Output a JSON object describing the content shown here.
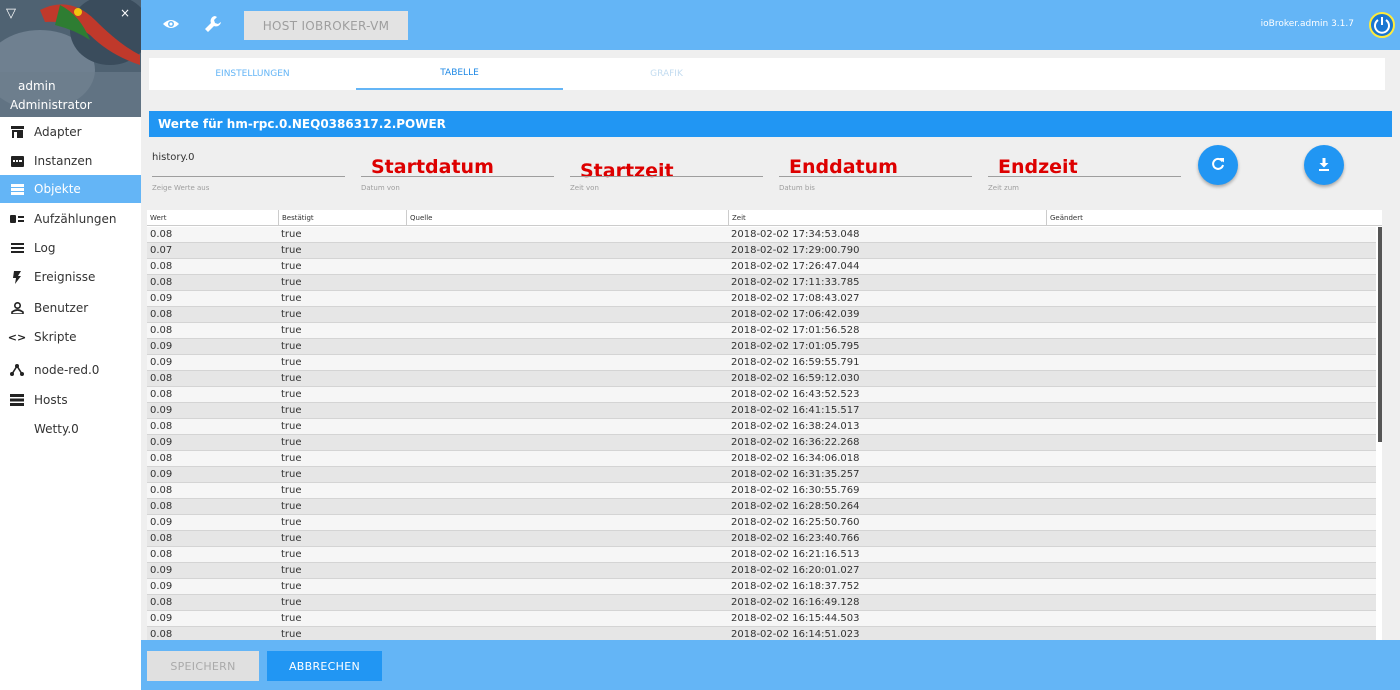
{
  "sidebar": {
    "user_name": "admin",
    "user_role": "Administrator",
    "items": [
      {
        "label": "Adapter",
        "icon": "store-icon"
      },
      {
        "label": "Instanzen",
        "icon": "instances-icon"
      },
      {
        "label": "Objekte",
        "icon": "list-icon",
        "active": true
      },
      {
        "label": "Aufzählungen",
        "icon": "enum-icon"
      },
      {
        "label": "Log",
        "icon": "log-icon"
      },
      {
        "label": "Ereignisse",
        "icon": "flash-icon"
      },
      {
        "label": "Benutzer",
        "icon": "user-icon"
      },
      {
        "label": "Skripte",
        "icon": "code-icon"
      },
      {
        "label": "node-red.0",
        "icon": "nodes-icon"
      },
      {
        "label": "Hosts",
        "icon": "server-icon"
      },
      {
        "label": "Wetty.0",
        "icon": ""
      }
    ]
  },
  "topbar": {
    "host_button": "HOST IOBROKER-VM",
    "version": "ioBroker.admin 3.1.7"
  },
  "tabs": [
    {
      "label": "EINSTELLUNGEN"
    },
    {
      "label": "TABELLE",
      "active": true
    },
    {
      "label": "GRAFIK",
      "disabled": true
    }
  ],
  "title": "Werte für hm-rpc.0.NEQ0386317.2.POWER",
  "fields": {
    "instance": {
      "value": "history.0",
      "label": "Zeige Werte aus"
    },
    "start_date": {
      "annotation": "Startdatum",
      "label": "Datum von"
    },
    "start_time": {
      "annotation": "Startzeit",
      "label": "Zeit von"
    },
    "end_date": {
      "annotation": "Enddatum",
      "label": "Datum bis"
    },
    "end_time": {
      "annotation": "Endzeit",
      "label": "Zeit zum"
    }
  },
  "table": {
    "headers": [
      "Wert",
      "Bestätigt",
      "Quelle",
      "Zeit",
      "Geändert"
    ],
    "rows": [
      [
        "0.08",
        "true",
        "",
        "2018-02-02 17:34:53.048",
        ""
      ],
      [
        "0.07",
        "true",
        "",
        "2018-02-02 17:29:00.790",
        ""
      ],
      [
        "0.08",
        "true",
        "",
        "2018-02-02 17:26:47.044",
        ""
      ],
      [
        "0.08",
        "true",
        "",
        "2018-02-02 17:11:33.785",
        ""
      ],
      [
        "0.09",
        "true",
        "",
        "2018-02-02 17:08:43.027",
        ""
      ],
      [
        "0.08",
        "true",
        "",
        "2018-02-02 17:06:42.039",
        ""
      ],
      [
        "0.08",
        "true",
        "",
        "2018-02-02 17:01:56.528",
        ""
      ],
      [
        "0.09",
        "true",
        "",
        "2018-02-02 17:01:05.795",
        ""
      ],
      [
        "0.09",
        "true",
        "",
        "2018-02-02 16:59:55.791",
        ""
      ],
      [
        "0.08",
        "true",
        "",
        "2018-02-02 16:59:12.030",
        ""
      ],
      [
        "0.08",
        "true",
        "",
        "2018-02-02 16:43:52.523",
        ""
      ],
      [
        "0.09",
        "true",
        "",
        "2018-02-02 16:41:15.517",
        ""
      ],
      [
        "0.08",
        "true",
        "",
        "2018-02-02 16:38:24.013",
        ""
      ],
      [
        "0.09",
        "true",
        "",
        "2018-02-02 16:36:22.268",
        ""
      ],
      [
        "0.08",
        "true",
        "",
        "2018-02-02 16:34:06.018",
        ""
      ],
      [
        "0.09",
        "true",
        "",
        "2018-02-02 16:31:35.257",
        ""
      ],
      [
        "0.08",
        "true",
        "",
        "2018-02-02 16:30:55.769",
        ""
      ],
      [
        "0.08",
        "true",
        "",
        "2018-02-02 16:28:50.264",
        ""
      ],
      [
        "0.09",
        "true",
        "",
        "2018-02-02 16:25:50.760",
        ""
      ],
      [
        "0.08",
        "true",
        "",
        "2018-02-02 16:23:40.766",
        ""
      ],
      [
        "0.08",
        "true",
        "",
        "2018-02-02 16:21:16.513",
        ""
      ],
      [
        "0.09",
        "true",
        "",
        "2018-02-02 16:20:01.027",
        ""
      ],
      [
        "0.09",
        "true",
        "",
        "2018-02-02 16:18:37.752",
        ""
      ],
      [
        "0.08",
        "true",
        "",
        "2018-02-02 16:16:49.128",
        ""
      ],
      [
        "0.09",
        "true",
        "",
        "2018-02-02 16:15:44.503",
        ""
      ],
      [
        "0.08",
        "true",
        "",
        "2018-02-02 16:14:51.023",
        ""
      ]
    ]
  },
  "footer": {
    "save_label": "SPEICHERN",
    "cancel_label": "ABBRECHEN"
  },
  "colors": {
    "primary": "#64b5f6",
    "accent": "#2196f3",
    "annotation": "#dd0000"
  }
}
